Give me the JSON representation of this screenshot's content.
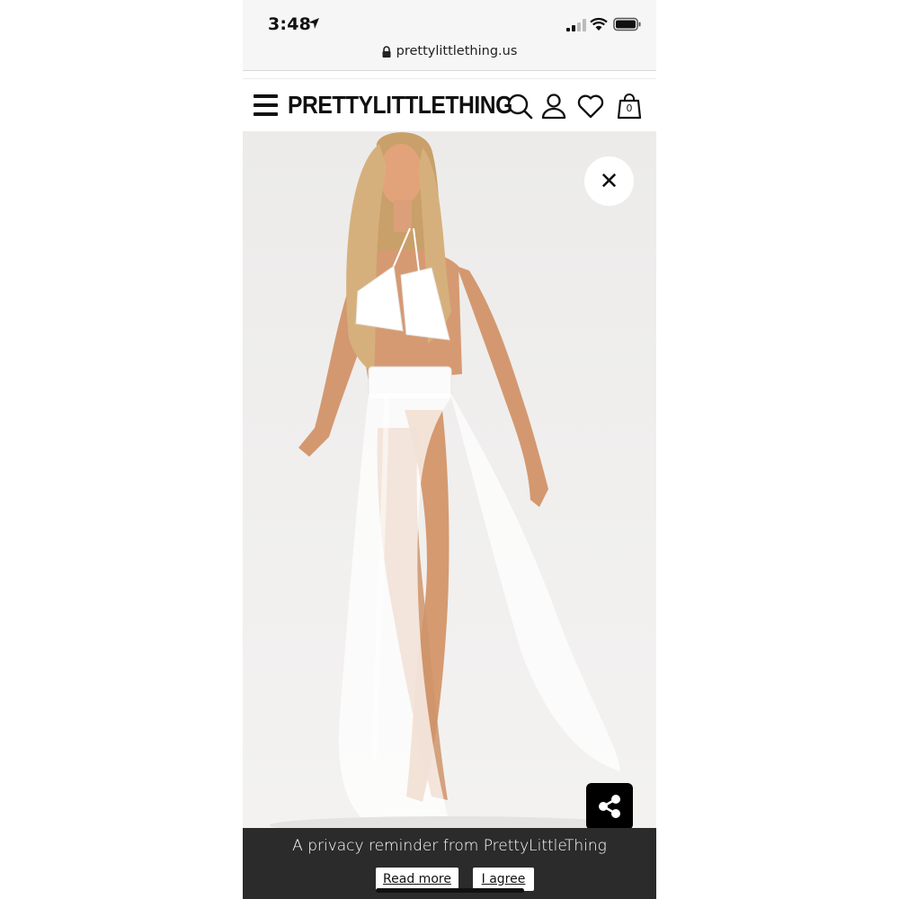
{
  "status_bar": {
    "time": "3:48",
    "icons": [
      "location-arrow-icon",
      "cellular-signal-icon",
      "wifi-icon",
      "battery-icon"
    ]
  },
  "browser": {
    "url": "prettylittlething.us",
    "icons": [
      "lock-icon"
    ]
  },
  "header": {
    "logo": "PRETTYLITTLETHING",
    "bag_count": "0",
    "icons": [
      "menu-icon",
      "search-icon",
      "account-icon",
      "heart-icon",
      "shopping-bag-icon"
    ]
  },
  "product_viewer": {
    "close_glyph": "✕",
    "icons": [
      "close-icon",
      "share-icon"
    ],
    "image": "model-photo"
  },
  "privacy_banner": {
    "message": "A privacy reminder from PrettyLittleThing",
    "read_more_label": "Read more",
    "agree_label": "I agree"
  },
  "colors": {
    "banner_bg": "#2b2b2b",
    "share_bg": "#000000",
    "image_bg": "#efeeed"
  }
}
